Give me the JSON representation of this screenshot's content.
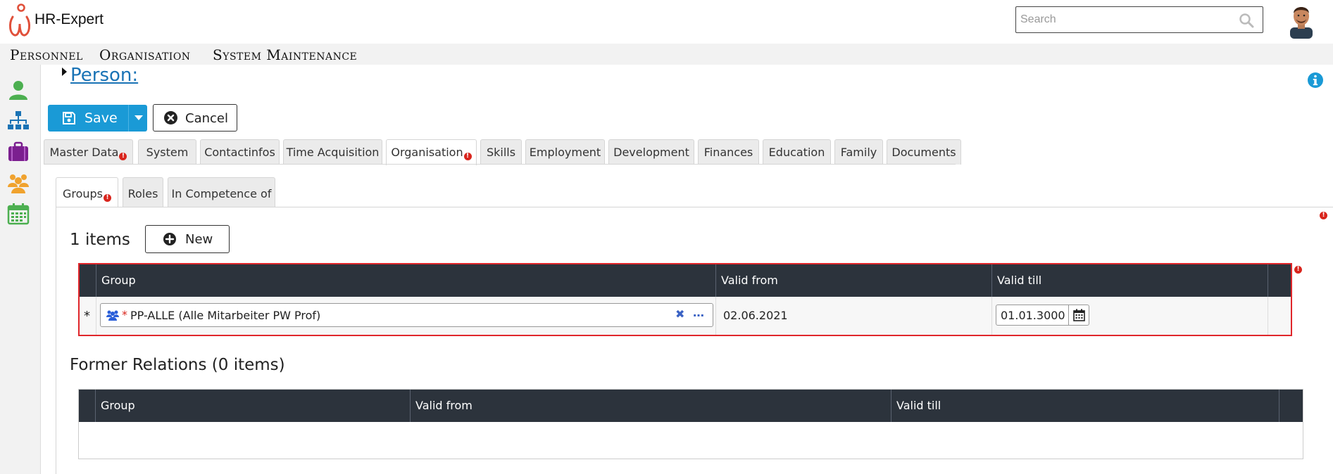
{
  "app": {
    "title": "HR-Expert"
  },
  "search": {
    "placeholder": "Search"
  },
  "menu": [
    "Personnel",
    "Organisation",
    "System Maintenance"
  ],
  "sidebar": [
    {
      "icon": "user-icon"
    },
    {
      "icon": "org-chart-icon"
    },
    {
      "icon": "briefcase-icon"
    },
    {
      "icon": "team-icon"
    },
    {
      "icon": "calendar-icon"
    }
  ],
  "page": {
    "title": "Person:"
  },
  "toolbar": {
    "save_label": "Save",
    "cancel_label": "Cancel"
  },
  "tabs": [
    {
      "label": "Master Data",
      "error": true
    },
    {
      "label": "System",
      "error": false
    },
    {
      "label": "Contactinfos",
      "error": false
    },
    {
      "label": "Time Acquisition",
      "error": false
    },
    {
      "label": "Organisation",
      "error": true,
      "active": true
    },
    {
      "label": "Skills",
      "error": false
    },
    {
      "label": "Employment",
      "error": false
    },
    {
      "label": "Development",
      "error": false
    },
    {
      "label": "Finances",
      "error": false
    },
    {
      "label": "Education",
      "error": false
    },
    {
      "label": "Family",
      "error": false
    },
    {
      "label": "Documents",
      "error": false
    }
  ],
  "subtabs": [
    {
      "label": "Groups",
      "error": true,
      "active": true
    },
    {
      "label": "Roles",
      "error": false
    },
    {
      "label": "In Competence of",
      "error": false
    }
  ],
  "groups": {
    "count_label": "1 items",
    "new_label": "New",
    "columns": [
      "Group",
      "Valid from",
      "Valid till"
    ],
    "rows": [
      {
        "marker": "*",
        "group": "PP-ALLE (Alle Mitarbeiter PW Prof)",
        "required_mark": "*",
        "valid_from": "02.06.2021",
        "valid_till": "01.01.3000"
      }
    ]
  },
  "former": {
    "title": "Former Relations (0 items)",
    "columns": [
      "Group",
      "Valid from",
      "Valid till"
    ]
  },
  "colors": {
    "accent": "#1a9ad6",
    "header_dark": "#2c333c",
    "error": "#e0262b",
    "link": "#1a73b5"
  }
}
